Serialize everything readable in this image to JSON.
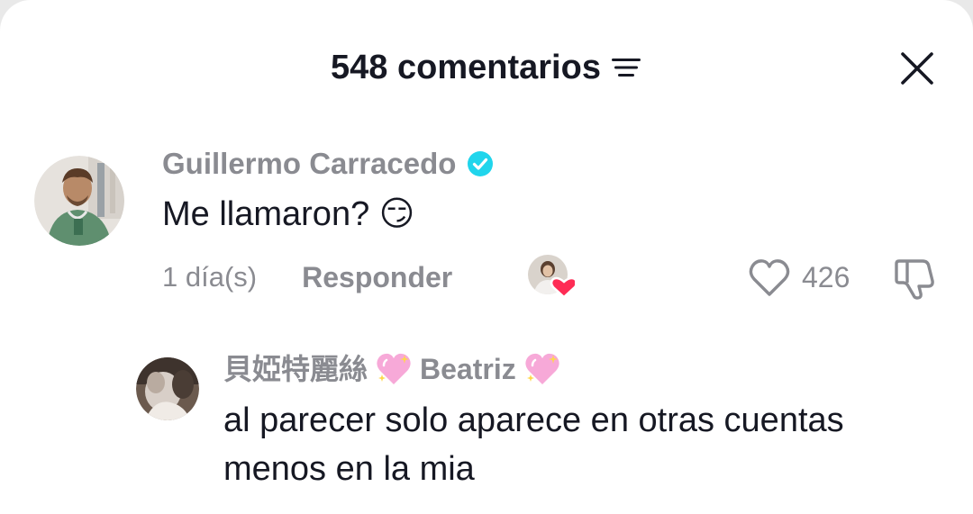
{
  "header": {
    "title": "548 comentarios",
    "filter_icon": "filter-lines-icon",
    "close_icon": "close-icon"
  },
  "comment": {
    "username": "Guillermo Carracedo",
    "verified_icon": "verified-badge-icon",
    "text": "Me llamaron? 😏",
    "time": "1 día(s)",
    "reply_label": "Responder",
    "creator_like_icon": "creator-liked-avatar-icon",
    "like_icon": "heart-outline-icon",
    "like_count": "426",
    "dislike_icon": "thumbs-down-icon"
  },
  "reply": {
    "username_prefix": "貝婭特麗絲",
    "username_suffix": "Beatriz",
    "heart_icon": "sparkling-heart-icon",
    "text": "al parecer solo aparece en otras cuentas menos en la mia"
  },
  "colors": {
    "text_primary": "#161823",
    "text_secondary": "#8a8b91",
    "verified_blue": "#20d5ec",
    "like_red": "#fe2c55"
  }
}
